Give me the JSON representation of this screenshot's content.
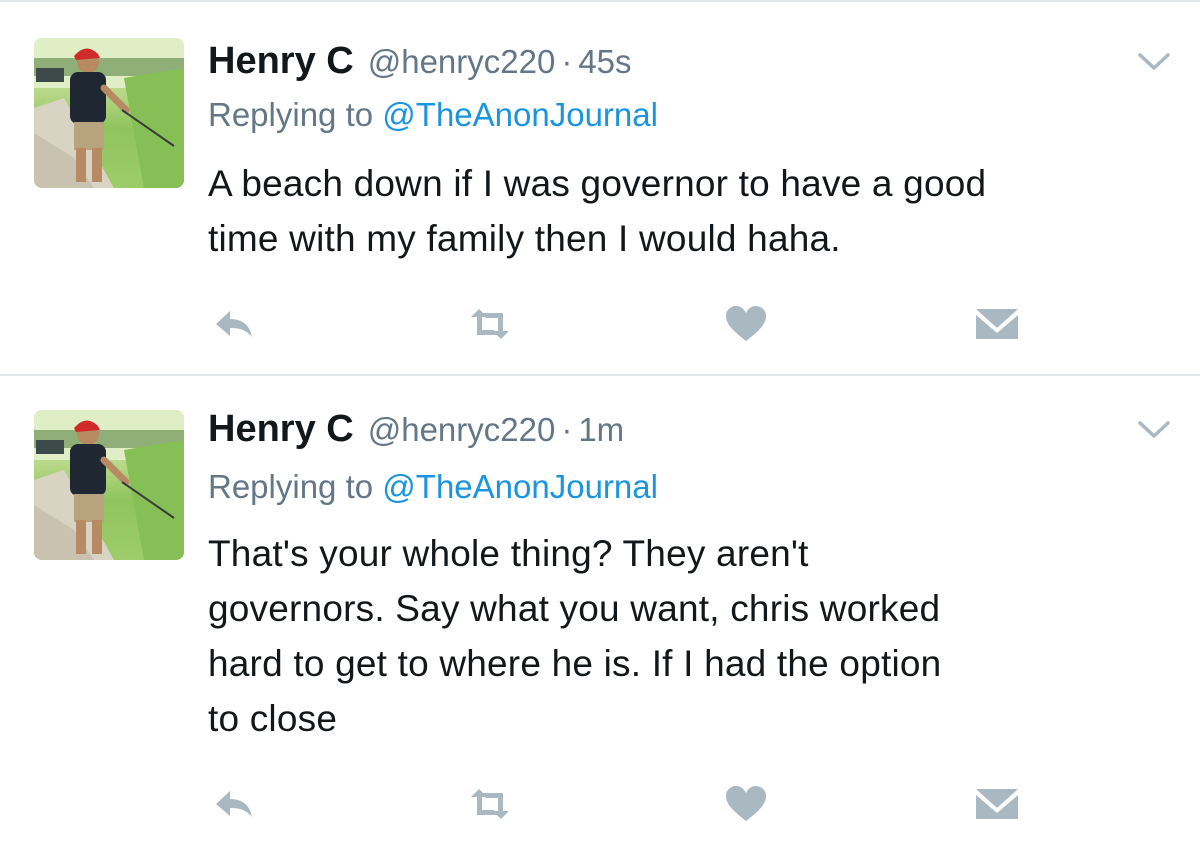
{
  "tweets": [
    {
      "author_name": "Henry C",
      "handle": "@henryc220",
      "separator": "·",
      "time": "45s",
      "reply_prefix": "Replying to",
      "reply_mention": "@TheAnonJournal",
      "text": "A beach down if I was governor to have a good\ntime with my family then I would haha.",
      "avatar": "golfer-profile-photo"
    },
    {
      "author_name": "Henry C",
      "handle": "@henryc220",
      "separator": "·",
      "time": "1m",
      "reply_prefix": "Replying to",
      "reply_mention": "@TheAnonJournal",
      "text": "That's your whole thing? They aren't\ngovernors. Say what you want, chris worked\nhard to get to where he is. If I had the option\nto close",
      "avatar": "golfer-profile-photo"
    }
  ],
  "actions": [
    "reply-icon",
    "retweet-icon",
    "like-icon",
    "direct-message-icon"
  ],
  "menu_icon": "chevron-down-icon",
  "colors": {
    "text": "#14171a",
    "secondary": "#657786",
    "link": "#1b95e0",
    "icon": "#aab8c2",
    "divider": "#e1e8ed"
  }
}
